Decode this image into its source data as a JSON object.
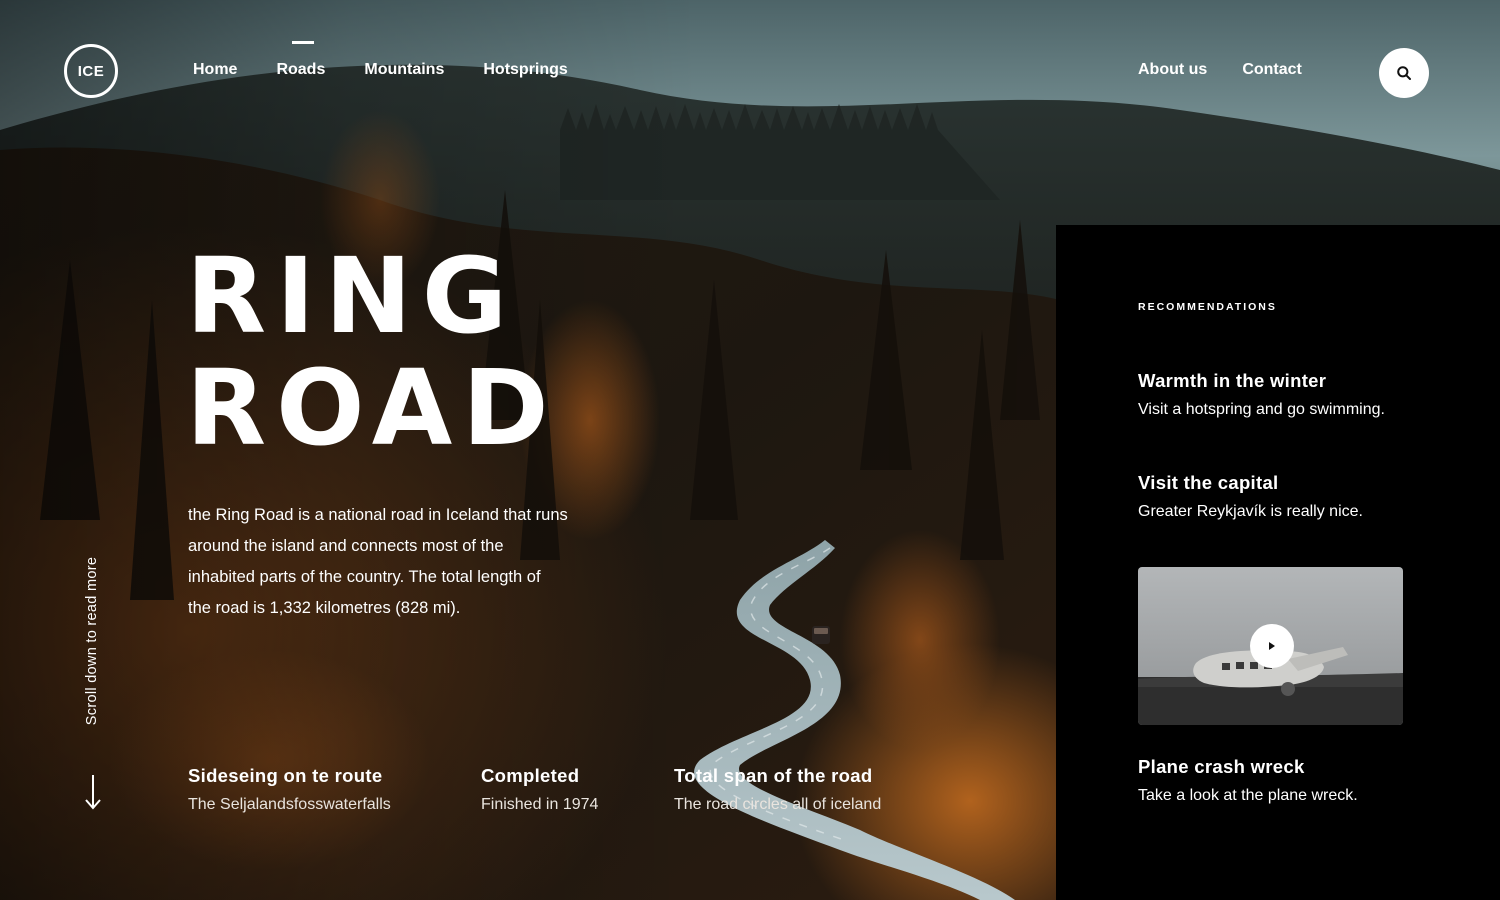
{
  "brand": {
    "logo_text": "ICE"
  },
  "nav": {
    "left": [
      {
        "label": "Home",
        "active": false
      },
      {
        "label": "Roads",
        "active": true
      },
      {
        "label": "Mountains",
        "active": false
      },
      {
        "label": "Hotsprings",
        "active": false
      }
    ],
    "right": [
      {
        "label": "About us"
      },
      {
        "label": "Contact"
      }
    ],
    "search_icon": "search-icon"
  },
  "hero": {
    "title_line_1": "RING",
    "title_line_2": "ROAD",
    "description": "the Ring Road is a national road in Iceland that runs around the island and connects most of the inhabited parts of the country. The total length of the road is 1,332 kilometres (828 mi).",
    "scroll_hint": "Scroll down to read more",
    "scroll_icon": "arrow-down-icon"
  },
  "facts": [
    {
      "title": "Sideseing on te route",
      "subtitle": "The Seljalandsfosswaterfalls"
    },
    {
      "title": "Completed",
      "subtitle": "Finished in 1974"
    },
    {
      "title": "Total span of the road",
      "subtitle": "The road circles all of iceland"
    }
  ],
  "sidebar": {
    "heading": "RECOMMENDATIONS",
    "items": [
      {
        "title": "Warmth in the winter",
        "subtitle": "Visit a hotspring and go swimming."
      },
      {
        "title": "Visit the capital",
        "subtitle": "Greater Reykjavík is really nice."
      },
      {
        "title": "Plane crash wreck",
        "subtitle": "Take a look at the plane wreck."
      }
    ],
    "video_icon": "play-icon"
  },
  "colors": {
    "sidebar_bg": "#000000",
    "text": "#ffffff",
    "forest_dark": "#1a1712",
    "autumn_orange": "#b0621e",
    "road": "#9fb3b8",
    "sky": "#6f8b90"
  }
}
